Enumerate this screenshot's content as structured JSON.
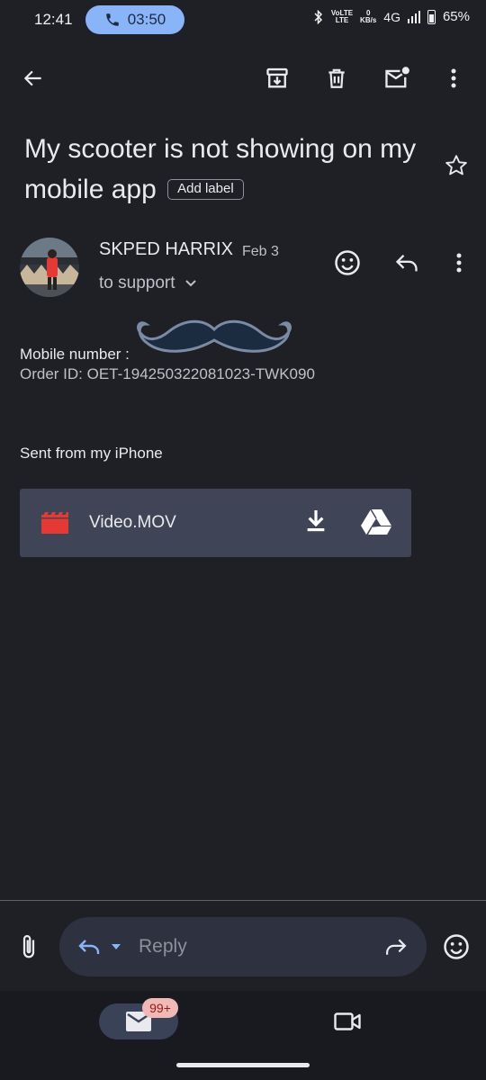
{
  "status_bar": {
    "time": "12:41",
    "call_timer": "03:50",
    "volte_top": "VoLTE",
    "volte_bottom": "LTE",
    "kbs_top": "0",
    "kbs_bottom": "KB/s",
    "network": "4G",
    "battery": "65%",
    "icons": [
      "phone-icon",
      "bluetooth-icon",
      "signal-icon",
      "battery-icon"
    ]
  },
  "toolbar": {
    "icons": [
      "back-arrow-icon",
      "archive-icon",
      "delete-icon",
      "mark-unread-icon",
      "more-vert-icon"
    ]
  },
  "email": {
    "subject": "My scooter is not showing on my mobile app",
    "label_button": "Add label",
    "sender_name": "SKPED HARRIX",
    "date": "Feb 3",
    "recipient": "to support",
    "body": {
      "mobile_number_label": "Mobile number : ",
      "order_id": "Order ID: OET-194250322081023-TWK090",
      "signature": "Sent from my iPhone"
    },
    "attachment": {
      "name": "Video.MOV",
      "icons": [
        "movie-icon",
        "download-icon",
        "google-drive-icon"
      ]
    }
  },
  "reply_bar": {
    "placeholder": "Reply"
  },
  "bottom_nav": {
    "mail_badge": "99+",
    "tabs": [
      "mail-icon",
      "video-camera-icon"
    ]
  },
  "colors": {
    "background": "#1f2026",
    "accent": "#8ab4f8",
    "attachment_bg": "#3f4556",
    "movie_icon": "#e53935",
    "badge_bg": "#f2b8b5"
  }
}
